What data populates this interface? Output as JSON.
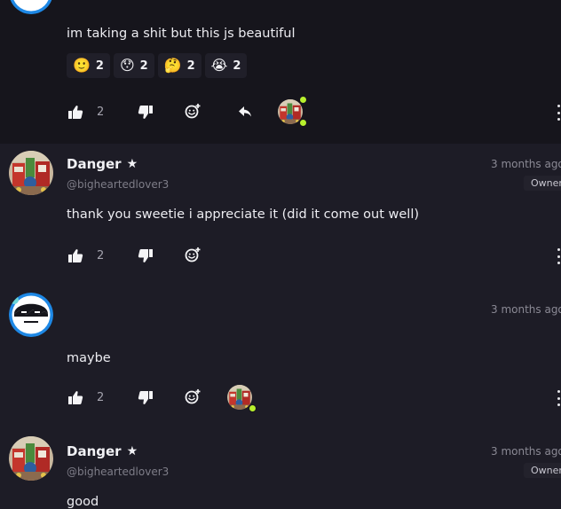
{
  "comments": [
    {
      "text": "im taking a shit but this js beautiful",
      "reactions": [
        {
          "emoji": "🙂",
          "count": "2"
        },
        {
          "emoji": "😯",
          "count": "2"
        },
        {
          "emoji": "🤔",
          "count": "2"
        },
        {
          "emoji": "😭",
          "count": "2"
        }
      ],
      "likes": "2"
    },
    {
      "name": "Danger",
      "star": "★",
      "handle": "@bigheartedlover3",
      "time": "3 months ago",
      "badge": "Owner",
      "text": "thank you sweetie i appreciate it (did it come out well)",
      "likes": "2"
    },
    {
      "time": "3 months ago",
      "text": "maybe",
      "likes": "2"
    },
    {
      "name": "Danger",
      "star": "★",
      "handle": "@bigheartedlover3",
      "time": "3 months ago",
      "badge": "Owner",
      "text": "good"
    }
  ],
  "icons": {
    "like": "thumbs-up-icon",
    "dislike": "thumbs-down-icon",
    "react": "add-reaction-icon",
    "reply": "reply-arrow-icon",
    "more": "more-vertical-icon"
  },
  "colors": {
    "background": "#1d1c26",
    "highlight_row": "#16151c",
    "online": "#b8f02d",
    "avatar_ring": "#1e88e5"
  }
}
